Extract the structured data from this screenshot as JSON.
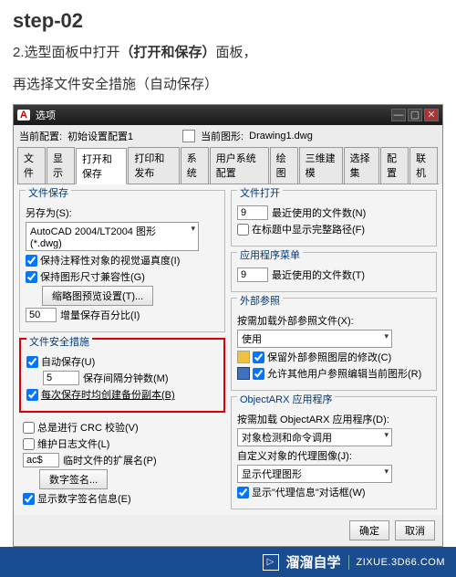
{
  "step_title": "step-02",
  "desc_line1_a": "2.选型面板中打开",
  "desc_line1_b": "（打开和保存）",
  "desc_line1_c": "面板，",
  "desc_line2": "再选择文件安全措施（自动保存）",
  "callout_num": "2",
  "window": {
    "title": "选项",
    "top": {
      "config_label": "当前配置:",
      "config_value": "初始设置配置1",
      "drawing_label": "当前图形:",
      "drawing_value": "Drawing1.dwg"
    },
    "tabs": [
      "文件",
      "显示",
      "打开和保存",
      "打印和发布",
      "系统",
      "用户系统配置",
      "绘图",
      "三维建模",
      "选择集",
      "配置",
      "联机"
    ],
    "active_tab_index": 2,
    "left": {
      "save": {
        "title": "文件保存",
        "save_as": "另存为(S):",
        "format": "AutoCAD 2004/LT2004 图形 (*.dwg)",
        "annot_fidelity": "保持注释性对象的视觉逼真度(I)",
        "size_compat": "保持图形尺寸兼容性(G)",
        "thumbnail_btn": "缩略图预览设置(T)...",
        "incr_pct_label": "增量保存百分比(I)",
        "incr_pct_val": "50"
      },
      "safety": {
        "title": "文件安全措施",
        "autosave": "自动保存(U)",
        "interval_label": "保存间隔分钟数(M)",
        "interval_val": "5",
        "backup_copy": "每次保存时均创建备份副本(B)",
        "crc": "总是进行 CRC 校验(V)",
        "log": "维护日志文件(L)",
        "ext_label": "临时文件的扩展名(P)",
        "ext_val": "ac$",
        "digsig_btn": "数字签名...",
        "show_digsig": "显示数字签名信息(E)"
      }
    },
    "right": {
      "open": {
        "title": "文件打开",
        "recent_count": "9",
        "recent_label": "最近使用的文件数(N)",
        "fullpath": "在标题中显示完整路径(F)"
      },
      "menu": {
        "title": "应用程序菜单",
        "recent_count": "9",
        "recent_label": "最近使用的文件数(T)"
      },
      "xref": {
        "title": "外部参照",
        "demand_label": "按需加载外部参照文件(X):",
        "demand_val": "使用",
        "retain_changes": "保留外部参照图层的修改(C)",
        "allow_edit": "允许其他用户参照编辑当前图形(R)"
      },
      "arx": {
        "title": "ObjectARX 应用程序",
        "demand_label": "按需加载 ObjectARX 应用程序(D):",
        "demand_val": "对象检测和命令调用",
        "proxy_label": "自定义对象的代理图像(J):",
        "proxy_val": "显示代理图形",
        "show_proxy_dlg": "显示\"代理信息\"对话框(W)"
      }
    },
    "buttons": {
      "ok": "确定",
      "cancel": "取消"
    }
  },
  "brand": {
    "name": "溜溜自学",
    "url": "ZIXUE.3D66.COM"
  }
}
